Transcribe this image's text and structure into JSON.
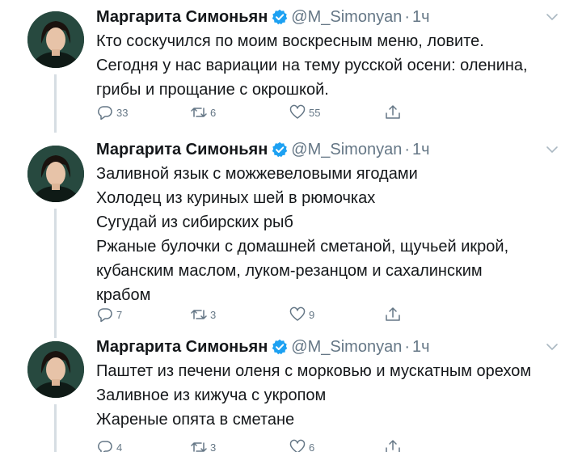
{
  "author": {
    "name": "Маргарита Симоньян",
    "handle": "@M_Simonyan",
    "time": "1ч"
  },
  "tweets": [
    {
      "lines": [
        "Кто соскучился по моим воскресным меню, ловите.",
        "Сегодня у нас вариации на тему русской осени: оленина,",
        "грибы и прощание с окрошкой."
      ],
      "replies": "33",
      "retweets": "6",
      "likes": "55"
    },
    {
      "lines": [
        "Заливной язык с  можжевеловыми ягодами",
        "Холодец из куриных шей в рюмочках",
        "Сугудай из сибирских рыб",
        "Ржаные булочки с домашней сметаной, щучьей икрой,",
        "кубанским маслом, луком-резанцом и сахалинским",
        "крабом"
      ],
      "replies": "7",
      "retweets": "3",
      "likes": "9"
    },
    {
      "lines": [
        "Паштет из печени оленя с морковью и мускатным орехом",
        "Заливное из кижуча с укропом",
        "Жареные опята в сметане"
      ],
      "replies": "4",
      "retweets": "3",
      "likes": "6"
    }
  ],
  "icons": {
    "reply": "reply-icon",
    "retweet": "retweet-icon",
    "like": "like-icon",
    "share": "share-icon",
    "verified": "verified-badge-icon",
    "caret": "chevron-down-icon"
  },
  "colors": {
    "icon_gray": "#657786",
    "verified_blue": "#1da1f2",
    "thread_line": "#d6dde3"
  }
}
